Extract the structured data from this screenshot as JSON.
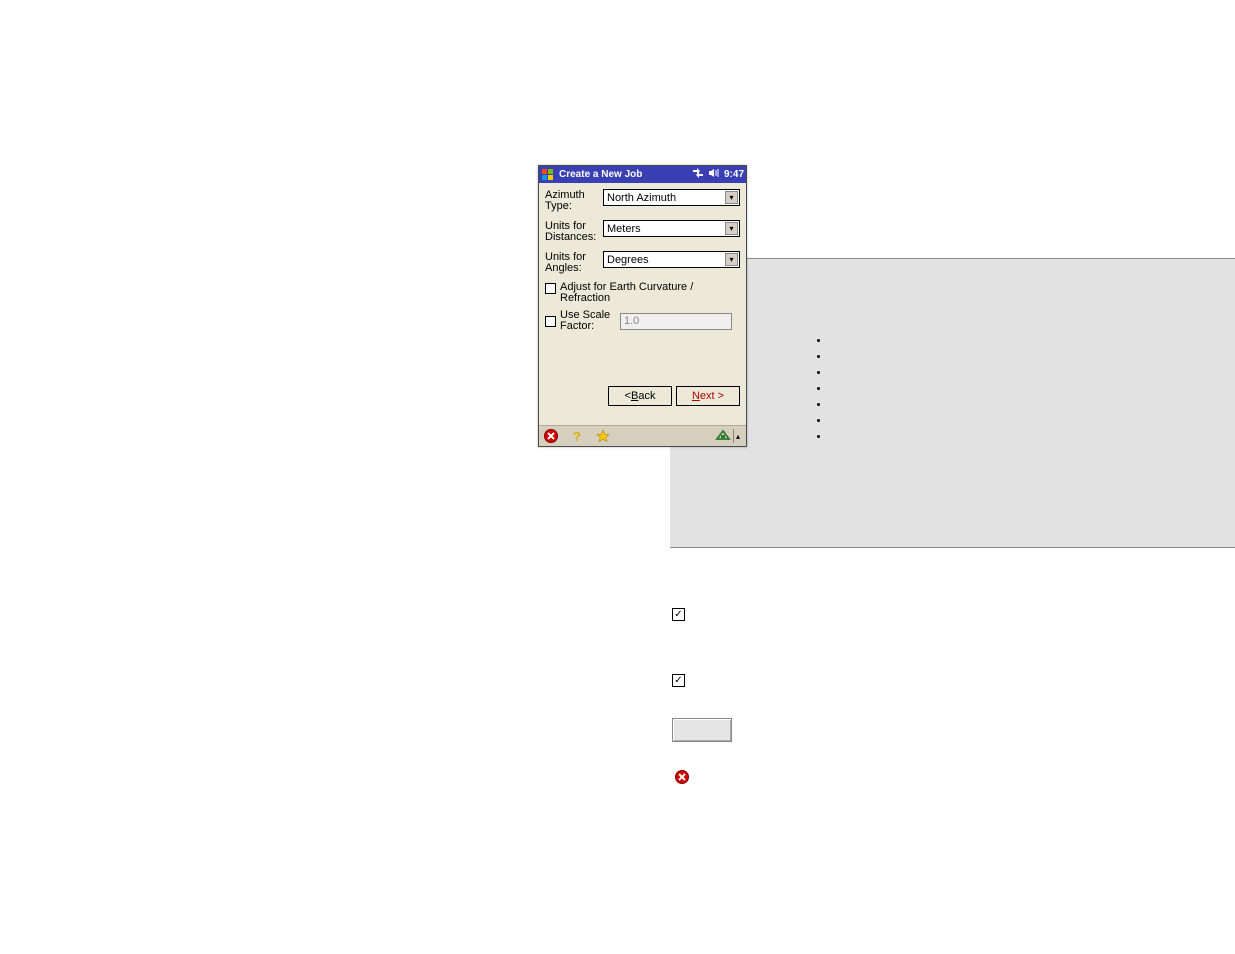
{
  "titlebar": {
    "title": "Create a New Job",
    "time": "9:47"
  },
  "fields": {
    "azimuth_label": "Azimuth Type:",
    "azimuth_value": "North Azimuth",
    "dist_label": "Units for Distances:",
    "dist_value": "Meters",
    "angle_label": "Units for Angles:",
    "angle_value": "Degrees",
    "adjust_label": "Adjust for Earth Curvature / Refraction",
    "scale_label": "Use Scale Factor:",
    "scale_value": "1.0"
  },
  "buttons": {
    "back_prefix": "< ",
    "back_letter": "B",
    "back_rest": "ack",
    "next_letter": "N",
    "next_rest": "ext >"
  },
  "bullets": [
    "",
    "",
    "",
    "",
    "",
    "",
    ""
  ],
  "checks": {
    "checkmark": "✓"
  }
}
